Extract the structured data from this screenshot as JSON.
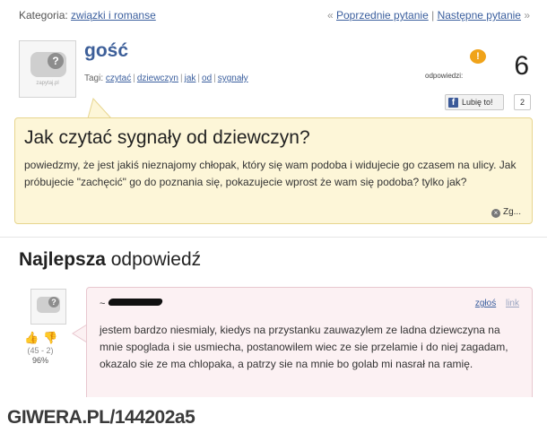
{
  "category": {
    "label": "Kategoria:",
    "value": "związki i romanse"
  },
  "nav": {
    "prev": "Poprzednie pytanie",
    "separator": "|",
    "next": "Następne pytanie",
    "prev_arrow": "«",
    "next_arrow": "»"
  },
  "question": {
    "avatar_icon": "anonymous-avatar-icon",
    "avatar_caption": "zapytaj.pl",
    "username": "gość",
    "tags_label": "Tagi:",
    "tags": [
      "czytać",
      "dziewczyn",
      "jak",
      "od",
      "sygnały"
    ],
    "answers_label": "odpowiedzi:",
    "answers_count": "6",
    "like_label": "Lubię to!",
    "like_count": "2",
    "title": "Jak czytać sygnały od dziewczyn?",
    "body": "powiedzmy, że jest jakiś nieznajomy chłopak, który się wam podoba i widujecie go czasem na ulicy. Jak próbujecie \"zachęcić\" go do poznania się, pokazujecie wprost że wam się podoba? tylko jak?",
    "report_label": "Zg..."
  },
  "best_answer": {
    "heading_bold": "Najlepsza",
    "heading_rest": "odpowiedź",
    "user_prefix": "~",
    "report_label": "zgłoś",
    "link_label": "link",
    "votes": "(45 - 2)",
    "percent": "96%",
    "body": "jestem bardzo niesmialy, kiedys na przystanku zauwazylem ze ladna dziewczyna na mnie spoglada i sie usmiecha, postanowilem wiec ze sie przelamie i do niej zagadam, okazalo sie ze ma chlopaka, a patrzy sie na mnie bo golab mi nasrał na ramię."
  },
  "watermark": "GIWERA.PL/144202a5",
  "colors": {
    "link": "#3b5f9e",
    "question_bg": "#fdf6d8",
    "answer_bg": "#fcf1f3",
    "answers_badge": "#f0a31a",
    "facebook": "#3b5998"
  }
}
